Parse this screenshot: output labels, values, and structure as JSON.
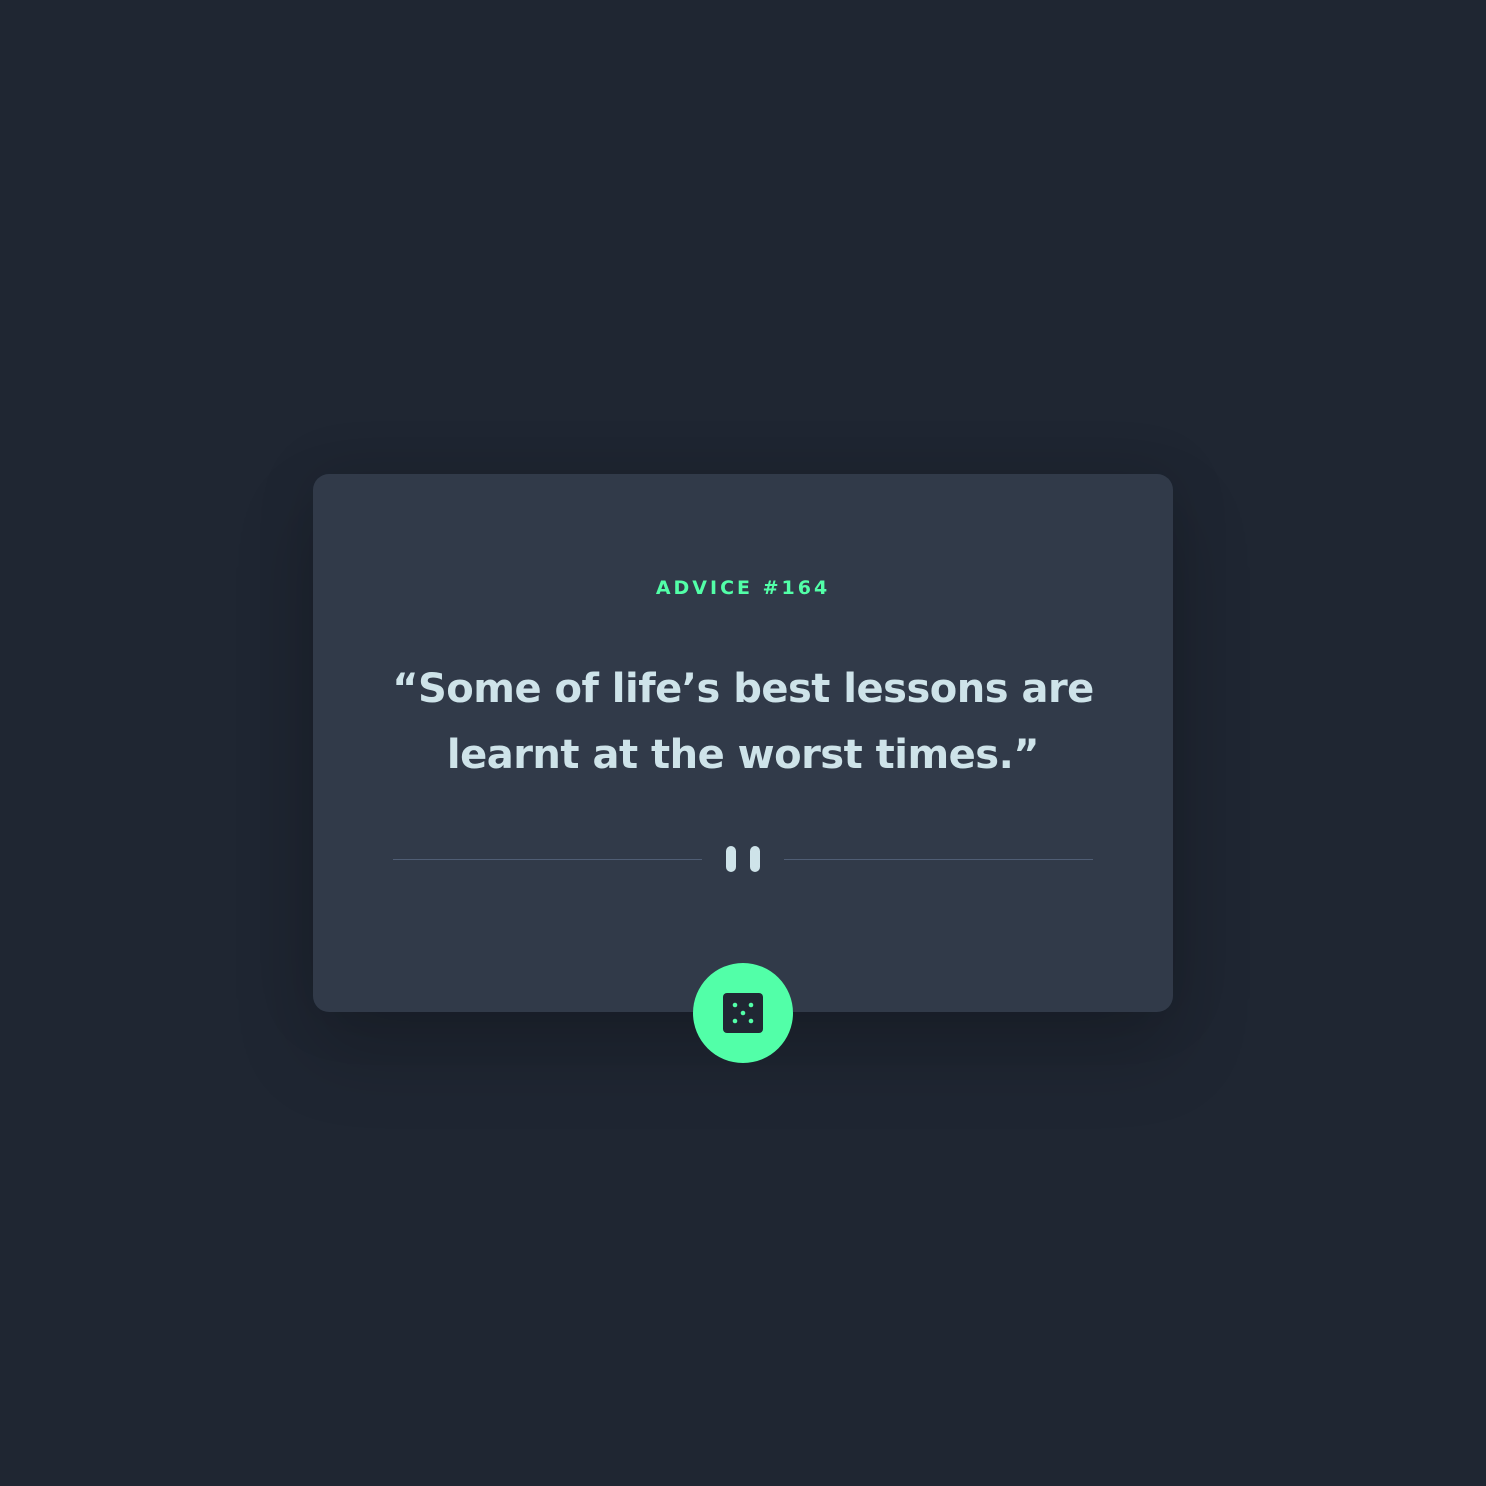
{
  "advice": {
    "label": "ADVICE #164",
    "quote": "“Some of life’s best lessons are learnt at the worst times.”"
  },
  "divider": {
    "icon": "pause-icon"
  },
  "dice_button": {
    "icon": "dice-icon"
  },
  "colors": {
    "background": "#1f2632",
    "card": "#313a49",
    "accent": "#52ffa8",
    "text": "#cee3e9",
    "divider_line": "#4f5d74"
  }
}
